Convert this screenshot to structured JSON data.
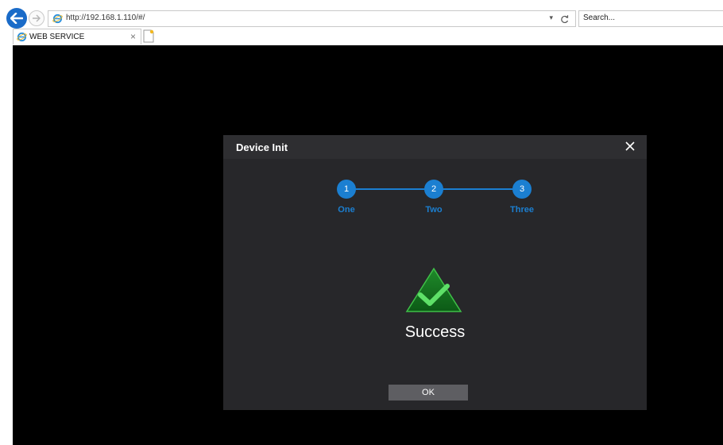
{
  "browser": {
    "url": "http://192.168.1.110/#/",
    "address_dropdown": "▾",
    "refresh_icon": "refresh-icon",
    "search_placeholder": "Search...",
    "tab_title": "WEB SERVICE",
    "tab_close": "×",
    "accent_color": "#1a6bc8"
  },
  "dialog": {
    "title": "Device Init",
    "close_label": "×",
    "steps": [
      {
        "number": "1",
        "label": "One"
      },
      {
        "number": "2",
        "label": "Two"
      },
      {
        "number": "3",
        "label": "Three"
      }
    ],
    "step_color": "#1b7fd1",
    "current_step": 3,
    "status_icon": "success-check-triangle-icon",
    "status_text": "Success",
    "ok_label": "OK"
  }
}
